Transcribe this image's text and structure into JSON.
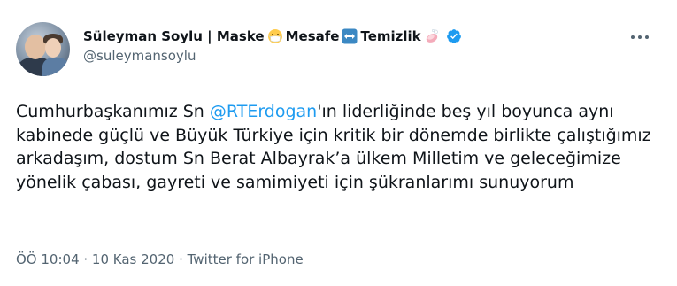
{
  "author": {
    "display_name_part1": "Süleyman Soylu | Maske",
    "display_name_part2": "Mesafe",
    "display_name_part3": "Temizlik",
    "handle": "@suleymansoylu",
    "emojis": [
      "mask-face-emoji",
      "left-right-arrow-emoji",
      "soap-emoji"
    ],
    "verified": true
  },
  "tweet": {
    "text_before": "Cumhurbaşkanımız Sn ",
    "mention": "@RTErdogan",
    "text_after": "'ın liderliğinde beş yıl boyunca aynı kabinede güçlü ve Büyük Türkiye için kritik bir dönemde birlikte çalıştığımız arkadaşım, dostum Sn Berat Albayrak’a ülkem Milletim ve geleceğimize yönelik çabası, gayreti ve samimiyeti için şükranlarımı sunuyorum"
  },
  "meta": {
    "time": "ÖÖ 10:04",
    "separator": " · ",
    "date": "10 Kas 2020",
    "app": "Twitter for iPhone"
  },
  "colors": {
    "mention": "#1d9bf0",
    "secondary_text": "#536471",
    "verified_badge": "#1d9bf0"
  }
}
